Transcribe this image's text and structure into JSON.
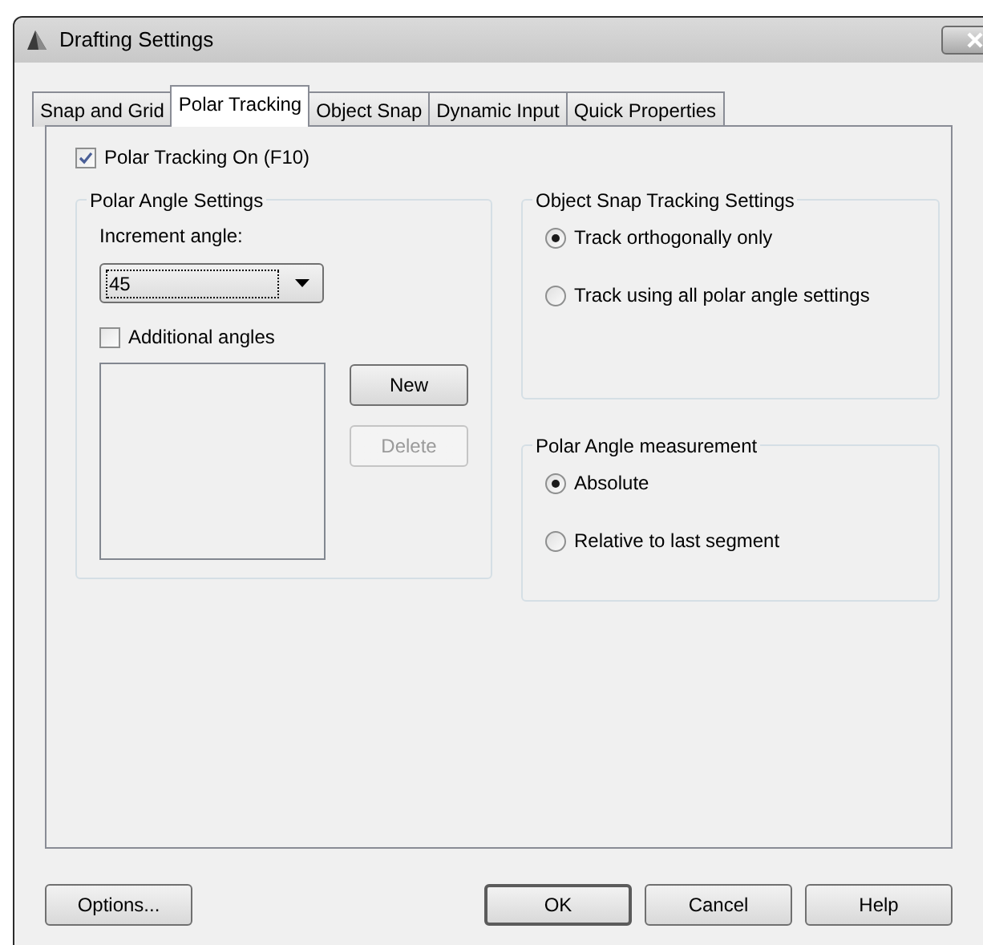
{
  "window": {
    "title": "Drafting Settings"
  },
  "tabs": [
    {
      "label": "Snap and Grid",
      "selected": false
    },
    {
      "label": "Polar Tracking",
      "selected": true
    },
    {
      "label": "Object Snap",
      "selected": false
    },
    {
      "label": "Dynamic Input",
      "selected": false
    },
    {
      "label": "Quick Properties",
      "selected": false
    }
  ],
  "polar_tracking_on": {
    "label": "Polar Tracking On (F10)",
    "checked": true
  },
  "polar_angle_settings": {
    "title": "Polar Angle Settings",
    "increment_label": "Increment angle:",
    "increment_value": "45",
    "additional_angles": {
      "label": "Additional angles",
      "checked": false
    },
    "buttons": [
      {
        "label": "New",
        "disabled": false
      },
      {
        "label": "Delete",
        "disabled": true
      }
    ]
  },
  "object_snap_tracking": {
    "title": "Object Snap Tracking Settings",
    "options": [
      {
        "label": "Track orthogonally only",
        "selected": true
      },
      {
        "label": "Track using all polar angle settings",
        "selected": false
      }
    ]
  },
  "polar_angle_measurement": {
    "title": "Polar Angle measurement",
    "options": [
      {
        "label": "Absolute",
        "selected": true
      },
      {
        "label": "Relative to last segment",
        "selected": false
      }
    ]
  },
  "footer_buttons": [
    {
      "label": "Options...",
      "default": false
    },
    {
      "label": "OK",
      "default": true
    },
    {
      "label": "Cancel",
      "default": false
    },
    {
      "label": "Help",
      "default": false
    }
  ]
}
